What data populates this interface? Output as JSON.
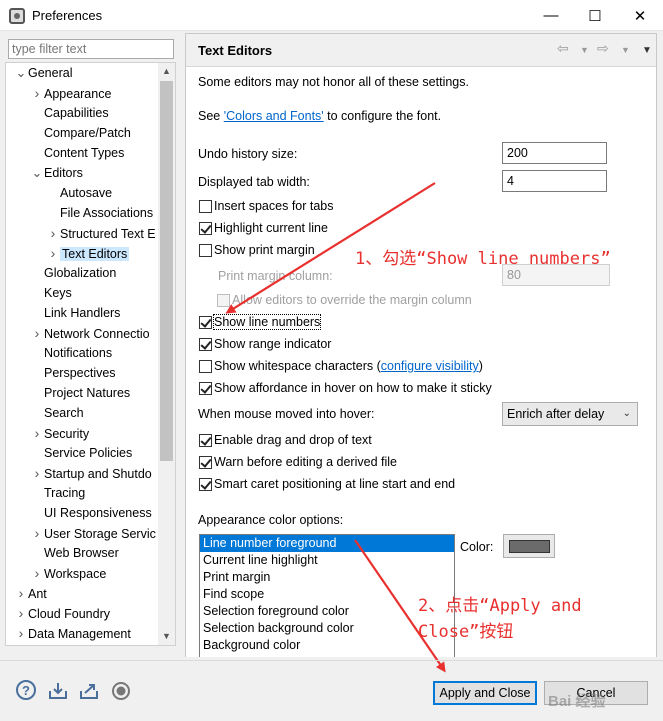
{
  "window": {
    "title": "Preferences",
    "minimize": "—",
    "maximize": "☐",
    "close": "✕"
  },
  "filter": {
    "placeholder": "type filter text"
  },
  "tree": [
    {
      "label": "General",
      "level": 0,
      "twisty": "open"
    },
    {
      "label": "Appearance",
      "level": 1,
      "twisty": "closed"
    },
    {
      "label": "Capabilities",
      "level": 1,
      "twisty": "none"
    },
    {
      "label": "Compare/Patch",
      "level": 1,
      "twisty": "none"
    },
    {
      "label": "Content Types",
      "level": 1,
      "twisty": "none"
    },
    {
      "label": "Editors",
      "level": 1,
      "twisty": "open"
    },
    {
      "label": "Autosave",
      "level": 2,
      "twisty": "none"
    },
    {
      "label": "File Associations",
      "level": 2,
      "twisty": "none"
    },
    {
      "label": "Structured Text E",
      "level": 2,
      "twisty": "closed"
    },
    {
      "label": "Text Editors",
      "level": 2,
      "twisty": "closed",
      "selected": true
    },
    {
      "label": "Globalization",
      "level": 1,
      "twisty": "none"
    },
    {
      "label": "Keys",
      "level": 1,
      "twisty": "none"
    },
    {
      "label": "Link Handlers",
      "level": 1,
      "twisty": "none"
    },
    {
      "label": "Network Connectio",
      "level": 1,
      "twisty": "closed"
    },
    {
      "label": "Notifications",
      "level": 1,
      "twisty": "none"
    },
    {
      "label": "Perspectives",
      "level": 1,
      "twisty": "none"
    },
    {
      "label": "Project Natures",
      "level": 1,
      "twisty": "none"
    },
    {
      "label": "Search",
      "level": 1,
      "twisty": "none"
    },
    {
      "label": "Security",
      "level": 1,
      "twisty": "closed"
    },
    {
      "label": "Service Policies",
      "level": 1,
      "twisty": "none"
    },
    {
      "label": "Startup and Shutdo",
      "level": 1,
      "twisty": "closed"
    },
    {
      "label": "Tracing",
      "level": 1,
      "twisty": "none"
    },
    {
      "label": "UI Responsiveness",
      "level": 1,
      "twisty": "none"
    },
    {
      "label": "User Storage Servic",
      "level": 1,
      "twisty": "closed"
    },
    {
      "label": "Web Browser",
      "level": 1,
      "twisty": "none"
    },
    {
      "label": "Workspace",
      "level": 1,
      "twisty": "closed"
    },
    {
      "label": "Ant",
      "level": 0,
      "twisty": "closed"
    },
    {
      "label": "Cloud Foundry",
      "level": 0,
      "twisty": "closed"
    },
    {
      "label": "Data Management",
      "level": 0,
      "twisty": "closed"
    }
  ],
  "page": {
    "title": "Text Editors",
    "intro": "Some editors may not honor all of these settings.",
    "see_prefix": "See ",
    "see_link": "'Colors and Fonts'",
    "see_suffix": " to configure the font.",
    "undo_label": "Undo history size:",
    "undo_value": "200",
    "tab_label": "Displayed tab width:",
    "tab_value": "4",
    "insert_spaces": "Insert spaces for tabs",
    "highlight_line": "Highlight current line",
    "show_margin": "Show print margin",
    "margin_col_label": "Print margin column:",
    "margin_col_value": "80",
    "allow_override": "Allow editors to override the margin column",
    "show_line_numbers": "Show line numbers",
    "show_range": "Show range indicator",
    "show_whitespace": "Show whitespace characters (",
    "configure_visibility": "configure visibility",
    "close_paren": ")",
    "show_affordance": "Show affordance in hover on how to make it sticky",
    "hover_label": "When mouse moved into hover:",
    "hover_value": "Enrich after delay",
    "drag_drop": "Enable drag and drop of text",
    "warn_derived": "Warn before editing a derived file",
    "smart_caret": "Smart caret positioning at line start and end",
    "appearance_label": "Appearance color options:",
    "color_label": "Color:",
    "swatch_color": "#6b6b6b",
    "color_options": [
      "Line number foreground",
      "Current line highlight",
      "Print margin",
      "Find scope",
      "Selection foreground color",
      "Selection background color",
      "Background color"
    ]
  },
  "checks": {
    "insert_spaces": false,
    "highlight_line": true,
    "show_margin": false,
    "allow_override": false,
    "show_line_numbers": true,
    "show_range": true,
    "show_whitespace": false,
    "show_affordance": true,
    "drag_drop": true,
    "warn_derived": true,
    "smart_caret": true
  },
  "annotations": {
    "step1": "1、勾选“Show line numbers”",
    "step2_line1": "2、点击“Apply and",
    "step2_line2": "Close”按钮",
    "color": "#e8312f"
  },
  "buttons": {
    "apply_close": "Apply and Close",
    "cancel": "Cancel"
  },
  "bottom_icons": [
    "help-icon",
    "import-icon",
    "export-icon",
    "record-icon"
  ],
  "watermark": "Bai 经验"
}
